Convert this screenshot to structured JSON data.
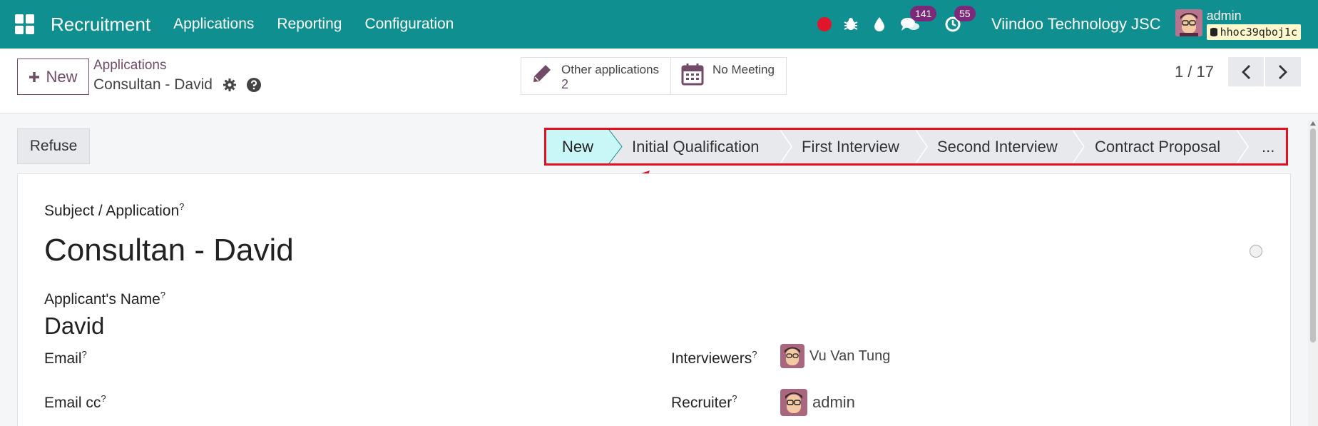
{
  "navbar": {
    "app_name": "Recruitment",
    "menu": [
      "Applications",
      "Reporting",
      "Configuration"
    ],
    "messages_count": "141",
    "activities_count": "55",
    "company": "Viindoo Technology JSC",
    "user": "admin",
    "database": "hhoc39qboj1c",
    "icons": [
      "apps-icon",
      "record-icon",
      "bug-icon",
      "drop-icon",
      "chat-icon",
      "clock-icon",
      "database-icon"
    ],
    "colors": {
      "bar": "#0f8f8f",
      "badge": "#7b2a7b",
      "record": "#e0152c"
    }
  },
  "control_panel": {
    "new_label": "New",
    "breadcrumb_parent": "Applications",
    "breadcrumb_current": "Consultan - David",
    "smart_buttons": [
      {
        "label": "Other applications",
        "value": "2",
        "icon": "pencil-icon"
      },
      {
        "label": "No Meeting",
        "icon": "calendar-icon"
      }
    ],
    "pager": "1 / 17",
    "brand_color": "#714b67"
  },
  "status": {
    "refuse_label": "Refuse",
    "stages": [
      "New",
      "Initial Qualification",
      "First Interview",
      "Second Interview",
      "Contract Proposal",
      "..."
    ],
    "active_stage": "New",
    "highlight_color": "#e10f1f"
  },
  "form": {
    "subject_label": "Subject / Application",
    "subject_value": "Consultan - David",
    "applicant_name_label": "Applicant's Name",
    "applicant_name_value": "David",
    "email_label": "Email",
    "email_cc_label": "Email cc",
    "interviewers_label": "Interviewers",
    "interviewers_value": "Vu Van Tung",
    "recruiter_label": "Recruiter",
    "recruiter_value": "admin",
    "help_mark": "?"
  }
}
